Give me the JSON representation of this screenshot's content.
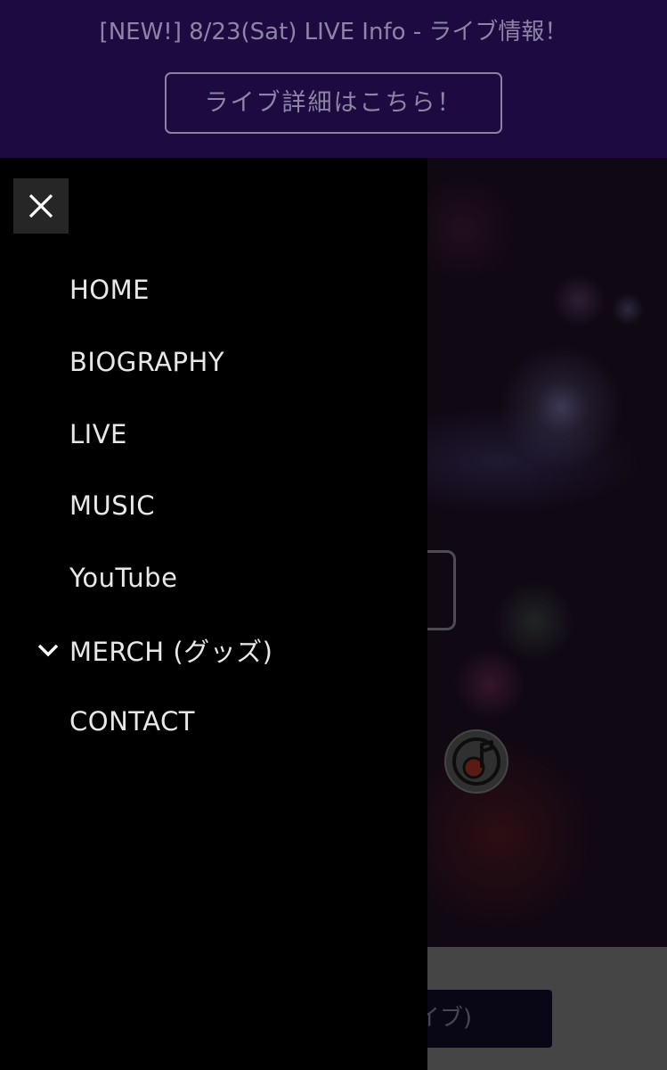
{
  "banner": {
    "text": "[NEW!] 8/23(Sat) LIVE Info - ライブ情報！",
    "button_label": "ライブ詳細はこちら！"
  },
  "drawer": {
    "close_icon": "close-icon",
    "items": [
      {
        "label": "HOME"
      },
      {
        "label": "BIOGRAPHY"
      },
      {
        "label": "LIVE"
      },
      {
        "label": "MUSIC"
      },
      {
        "label": "YouTube"
      },
      {
        "label": "MERCH (グッズ)",
        "icon": "chevron-down-icon"
      },
      {
        "label": "CONTACT"
      }
    ]
  },
  "background": {
    "logo_icon": "music-note-logo-icon",
    "partial_button_label": "イブ)"
  },
  "colors": {
    "banner_bg": "#1c0a40",
    "banner_text": "#8e84a6",
    "drawer_bg": "#000000",
    "drawer_text": "#e8e8e8",
    "close_button_bg": "#262626"
  }
}
